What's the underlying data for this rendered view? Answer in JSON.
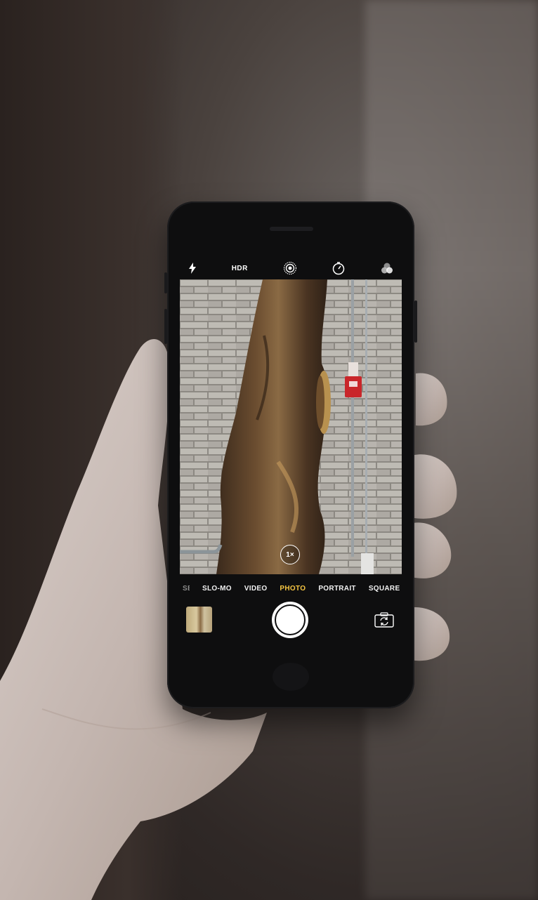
{
  "camera": {
    "top_bar": {
      "flash_icon": "flash-icon",
      "hdr_label": "HDR",
      "live_icon": "live-photo-icon",
      "timer_icon": "timer-icon",
      "filters_icon": "filters-icon"
    },
    "zoom_label": "1×",
    "modes": [
      "SE",
      "SLO-MO",
      "VIDEO",
      "PHOTO",
      "PORTRAIT",
      "SQUARE"
    ],
    "active_mode": "PHOTO",
    "shutter_icon": "shutter-button",
    "flip_icon": "flip-camera-icon",
    "accent_color": "#f5c542"
  }
}
